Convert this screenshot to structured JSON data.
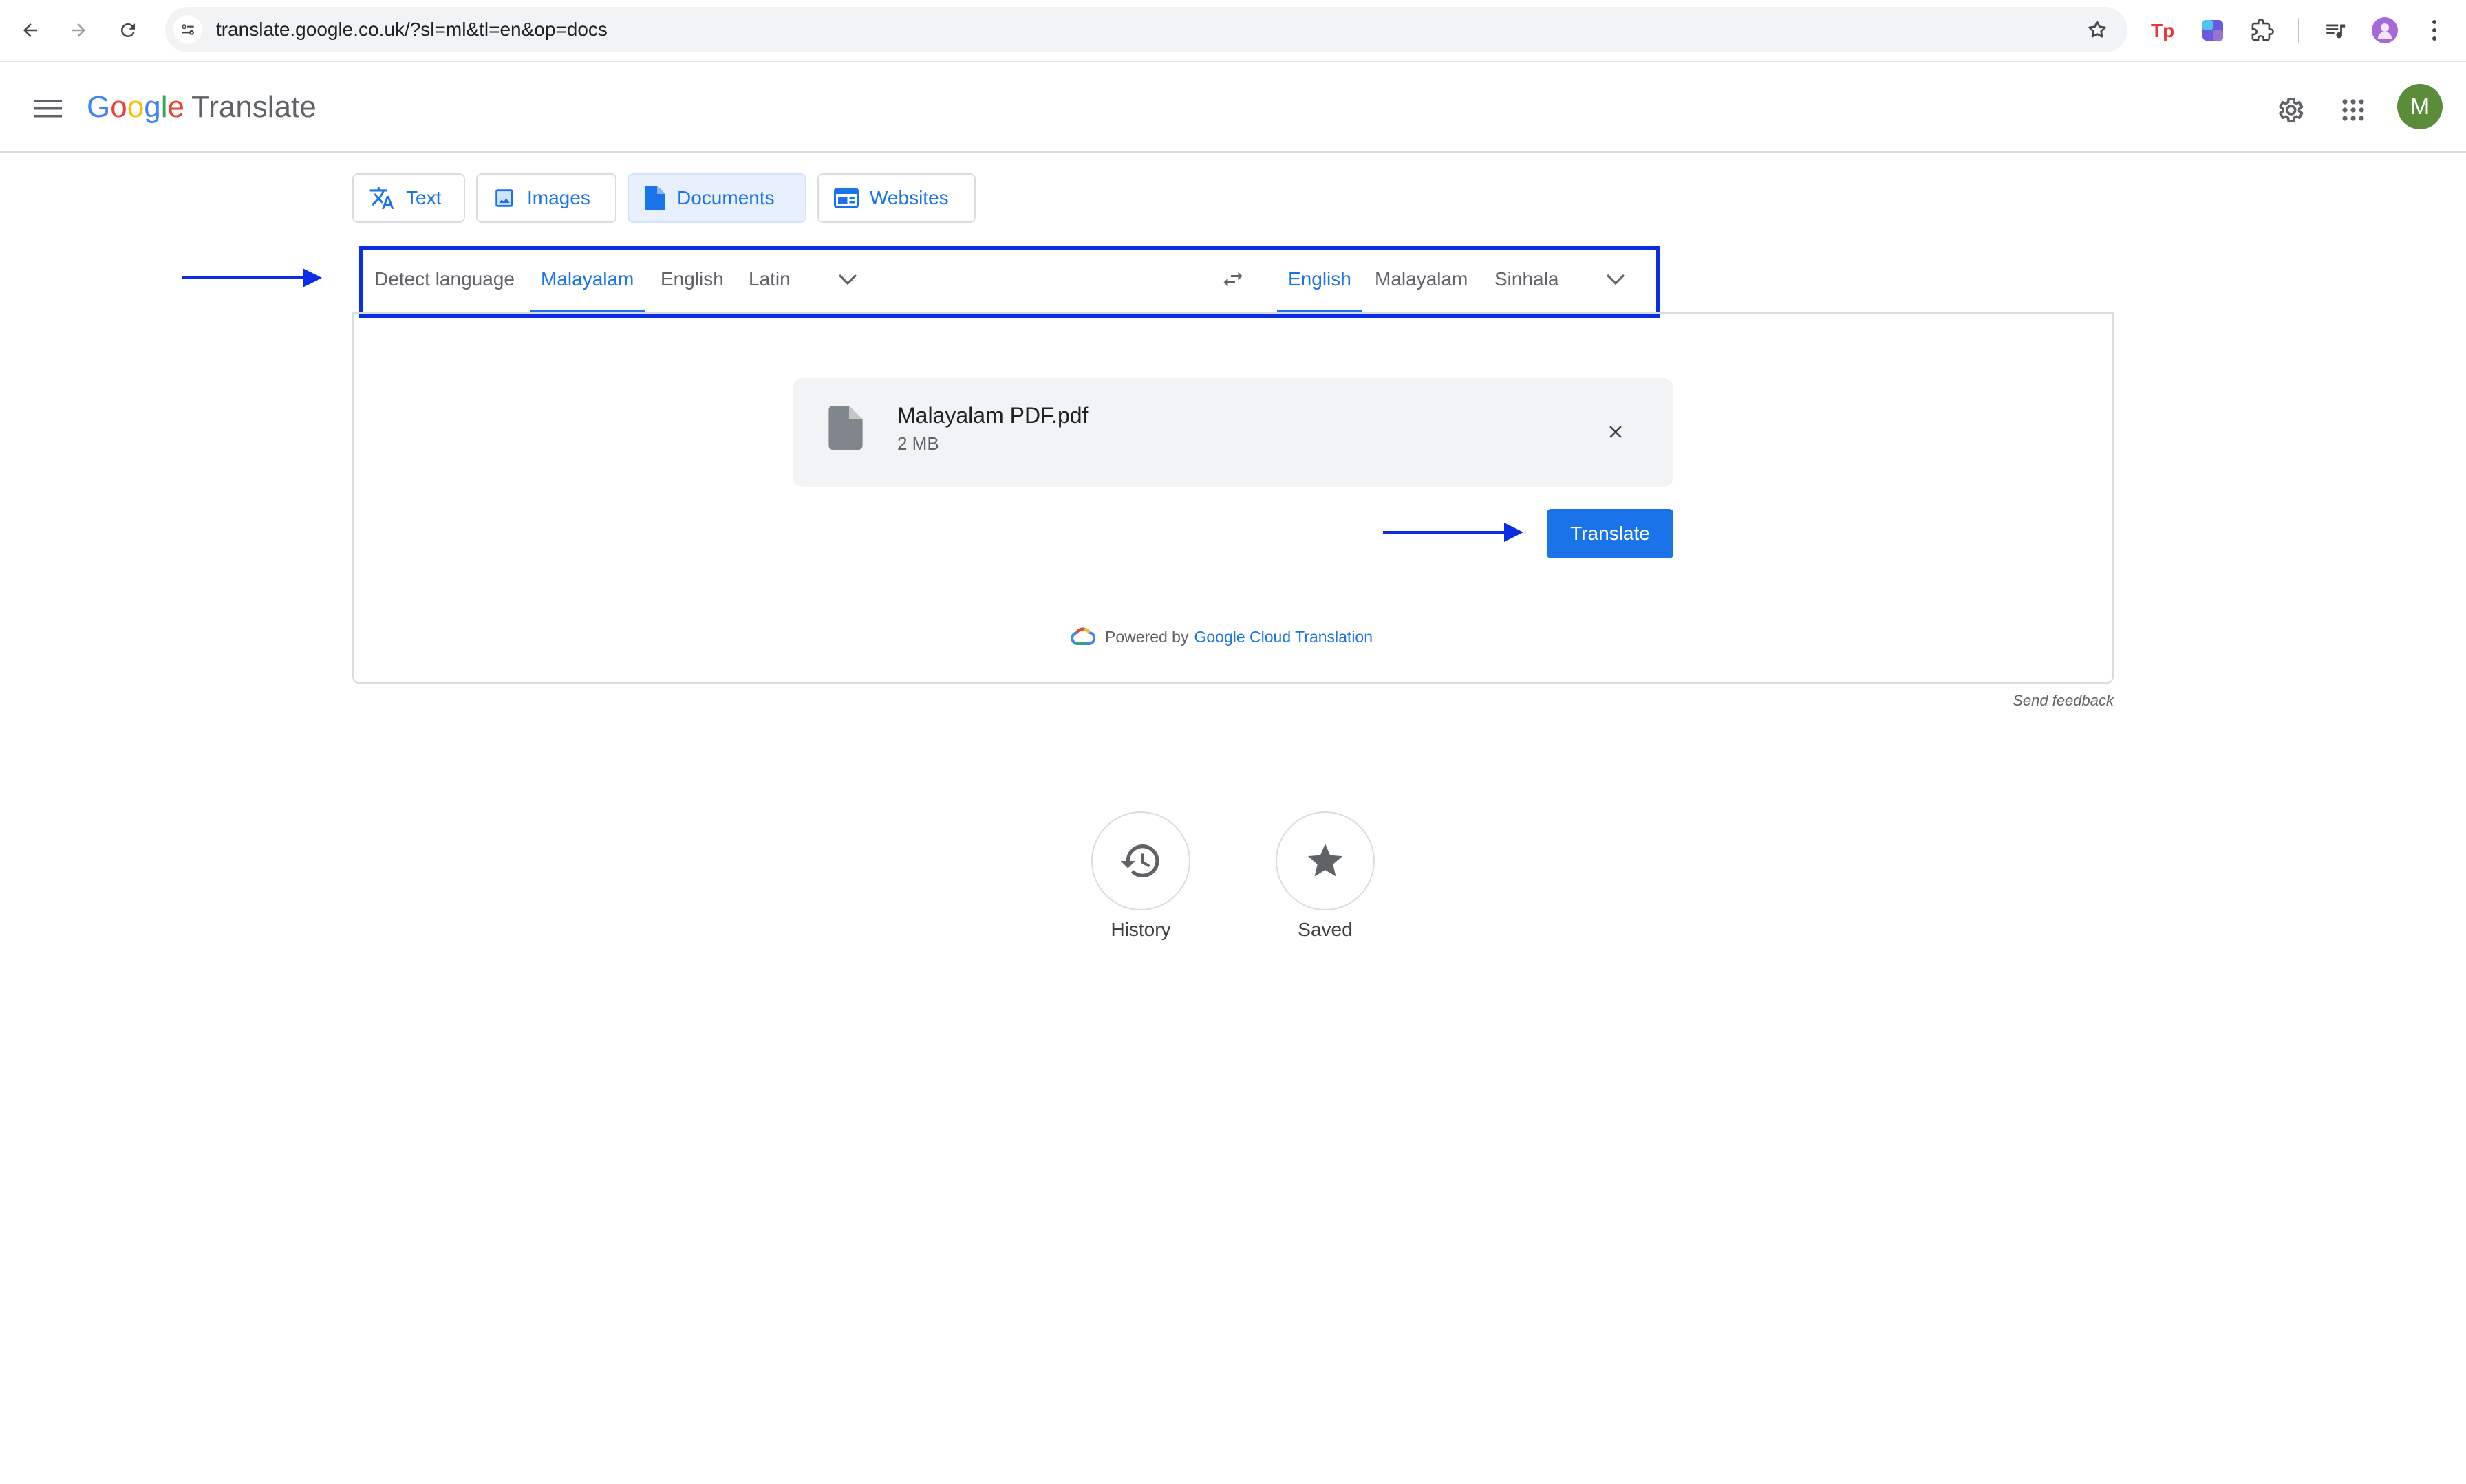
{
  "browser": {
    "url": "translate.google.co.uk/?sl=ml&tl=en&op=docs"
  },
  "header": {
    "logo_google": [
      "G",
      "o",
      "o",
      "g",
      "l",
      "e"
    ],
    "logo_colors": [
      "#4285f4",
      "#ea4335",
      "#fbbc05",
      "#4285f4",
      "#34a853",
      "#ea4335"
    ],
    "product": "Translate",
    "avatar_letter": "M"
  },
  "modes": {
    "text": "Text",
    "images": "Images",
    "documents": "Documents",
    "websites": "Websites",
    "active": "Documents"
  },
  "source_langs": {
    "detect": "Detect language",
    "items": [
      "Malayalam",
      "English",
      "Latin"
    ],
    "selected": "Malayalam"
  },
  "target_langs": {
    "items": [
      "English",
      "Malayalam",
      "Sinhala"
    ],
    "selected": "English"
  },
  "file": {
    "name": "Malayalam PDF.pdf",
    "size": "2 MB"
  },
  "actions": {
    "translate": "Translate"
  },
  "footer": {
    "powered_by": "Powered by",
    "powered_link": "Google Cloud Translation",
    "send_feedback": "Send feedback"
  },
  "shortcuts": {
    "history": "History",
    "saved": "Saved"
  },
  "colors": {
    "accent": "#1a73e8",
    "annotation": "#0b2ee3",
    "avatar": "#5b8c3a"
  }
}
